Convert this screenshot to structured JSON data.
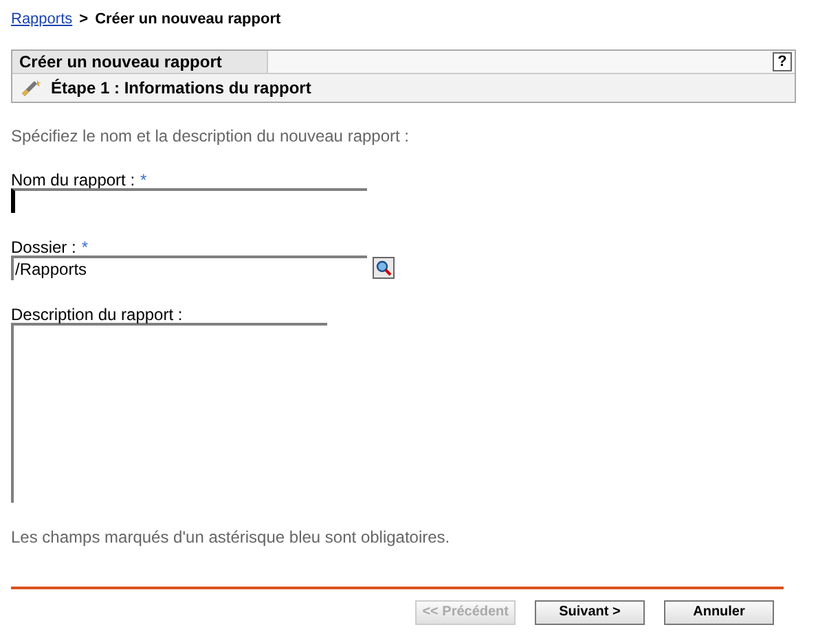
{
  "breadcrumb": {
    "link": "Rapports",
    "separator": ">",
    "current": "Créer un nouveau rapport"
  },
  "panel": {
    "title": "Créer un nouveau rapport",
    "help": "?",
    "step": "Étape 1 : Informations du rapport"
  },
  "intro": "Spécifiez le nom et la description du nouveau rapport :",
  "fields": [
    {
      "kind": "text",
      "label": "Nom du rapport :",
      "required_mark": "*",
      "focused": true
    },
    {
      "kind": "browse",
      "label": "Dossier :",
      "required_mark": "*",
      "value": "/Rapports",
      "focused": false
    },
    {
      "kind": "textarea",
      "label": "Description du rapport :",
      "focused": false
    }
  ],
  "note": "Les champs marqués d'un astérisque bleu sont obligatoires.",
  "buttons": [
    {
      "label": "<< Précédent",
      "disabled": true
    },
    {
      "label": "Suivant >",
      "disabled": false
    },
    {
      "label": "Annuler",
      "disabled": false
    }
  ]
}
